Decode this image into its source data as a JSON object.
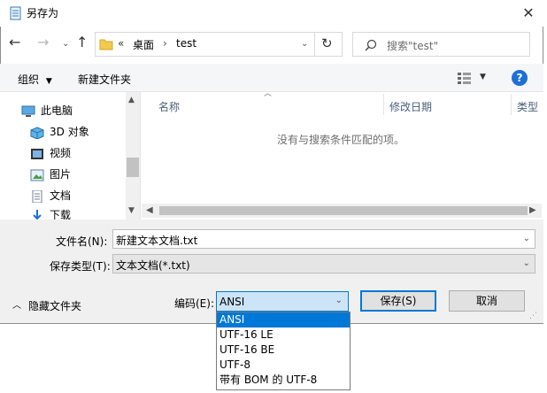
{
  "window": {
    "title": "另存为"
  },
  "address": {
    "crumb_overflow": "«",
    "crumbs": [
      "桌面",
      "test"
    ],
    "search_placeholder": "搜索\"test\""
  },
  "toolbar": {
    "organize": "组织",
    "new_folder": "新建文件夹"
  },
  "nav": {
    "items": [
      {
        "label": "此电脑",
        "icon": "computer-icon"
      },
      {
        "label": "3D 对象",
        "icon": "cube-icon"
      },
      {
        "label": "视频",
        "icon": "video-icon"
      },
      {
        "label": "图片",
        "icon": "picture-icon"
      },
      {
        "label": "文档",
        "icon": "document-icon"
      },
      {
        "label": "下载",
        "icon": "download-icon"
      }
    ]
  },
  "list": {
    "columns": [
      "名称",
      "修改日期",
      "类型"
    ],
    "empty_message": "没有与搜索条件匹配的项。"
  },
  "form": {
    "filename_label": "文件名(N):",
    "filename_value": "新建文本文档.txt",
    "filetype_label": "保存类型(T):",
    "filetype_value": "文本文档(*.txt)",
    "encoding_label": "编码(E):",
    "encoding_value": "ANSI",
    "encoding_options": [
      "ANSI",
      "UTF-16 LE",
      "UTF-16 BE",
      "UTF-8",
      "带有 BOM 的 UTF-8"
    ]
  },
  "footer": {
    "hide_folders": "隐藏文件夹",
    "save": "保存(S)",
    "cancel": "取消"
  },
  "colors": {
    "accent": "#0078d7",
    "help": "#1e6fd9",
    "folder": "#f3c94b"
  }
}
